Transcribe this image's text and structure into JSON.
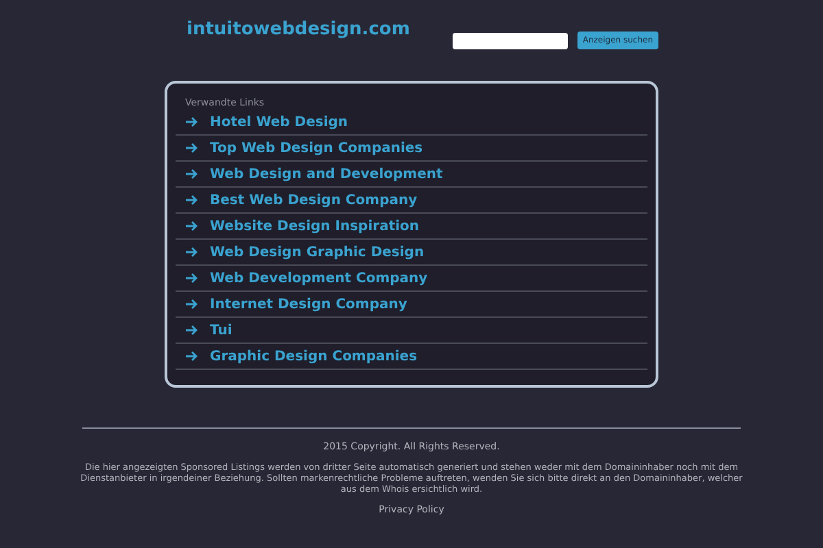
{
  "header": {
    "site_title": "intuitowebdesign.com",
    "search_button": "Anzeigen suchen"
  },
  "related_links": {
    "heading": "Verwandte Links",
    "items": [
      {
        "label": "Hotel Web Design"
      },
      {
        "label": "Top Web Design Companies"
      },
      {
        "label": "Web Design and Development"
      },
      {
        "label": "Best Web Design Company"
      },
      {
        "label": "Website Design Inspiration"
      },
      {
        "label": "Web Design Graphic Design"
      },
      {
        "label": "Web Development Company"
      },
      {
        "label": "Internet Design Company"
      },
      {
        "label": "Tui"
      },
      {
        "label": "Graphic Design Companies"
      }
    ]
  },
  "footer": {
    "copyright": "2015 Copyright. All Rights Reserved.",
    "disclaimer": "Die hier angezeigten Sponsored Listings werden von dritter Seite automatisch generiert und stehen weder mit dem Domaininhaber noch mit dem Dienstanbieter in irgendeiner Beziehung. Sollten markenrechtliche Probleme auftreten, wenden Sie sich bitte direkt an den Domaininhaber, welcher aus dem Whois ersichtlich wird.",
    "privacy_link": "Privacy Policy"
  }
}
